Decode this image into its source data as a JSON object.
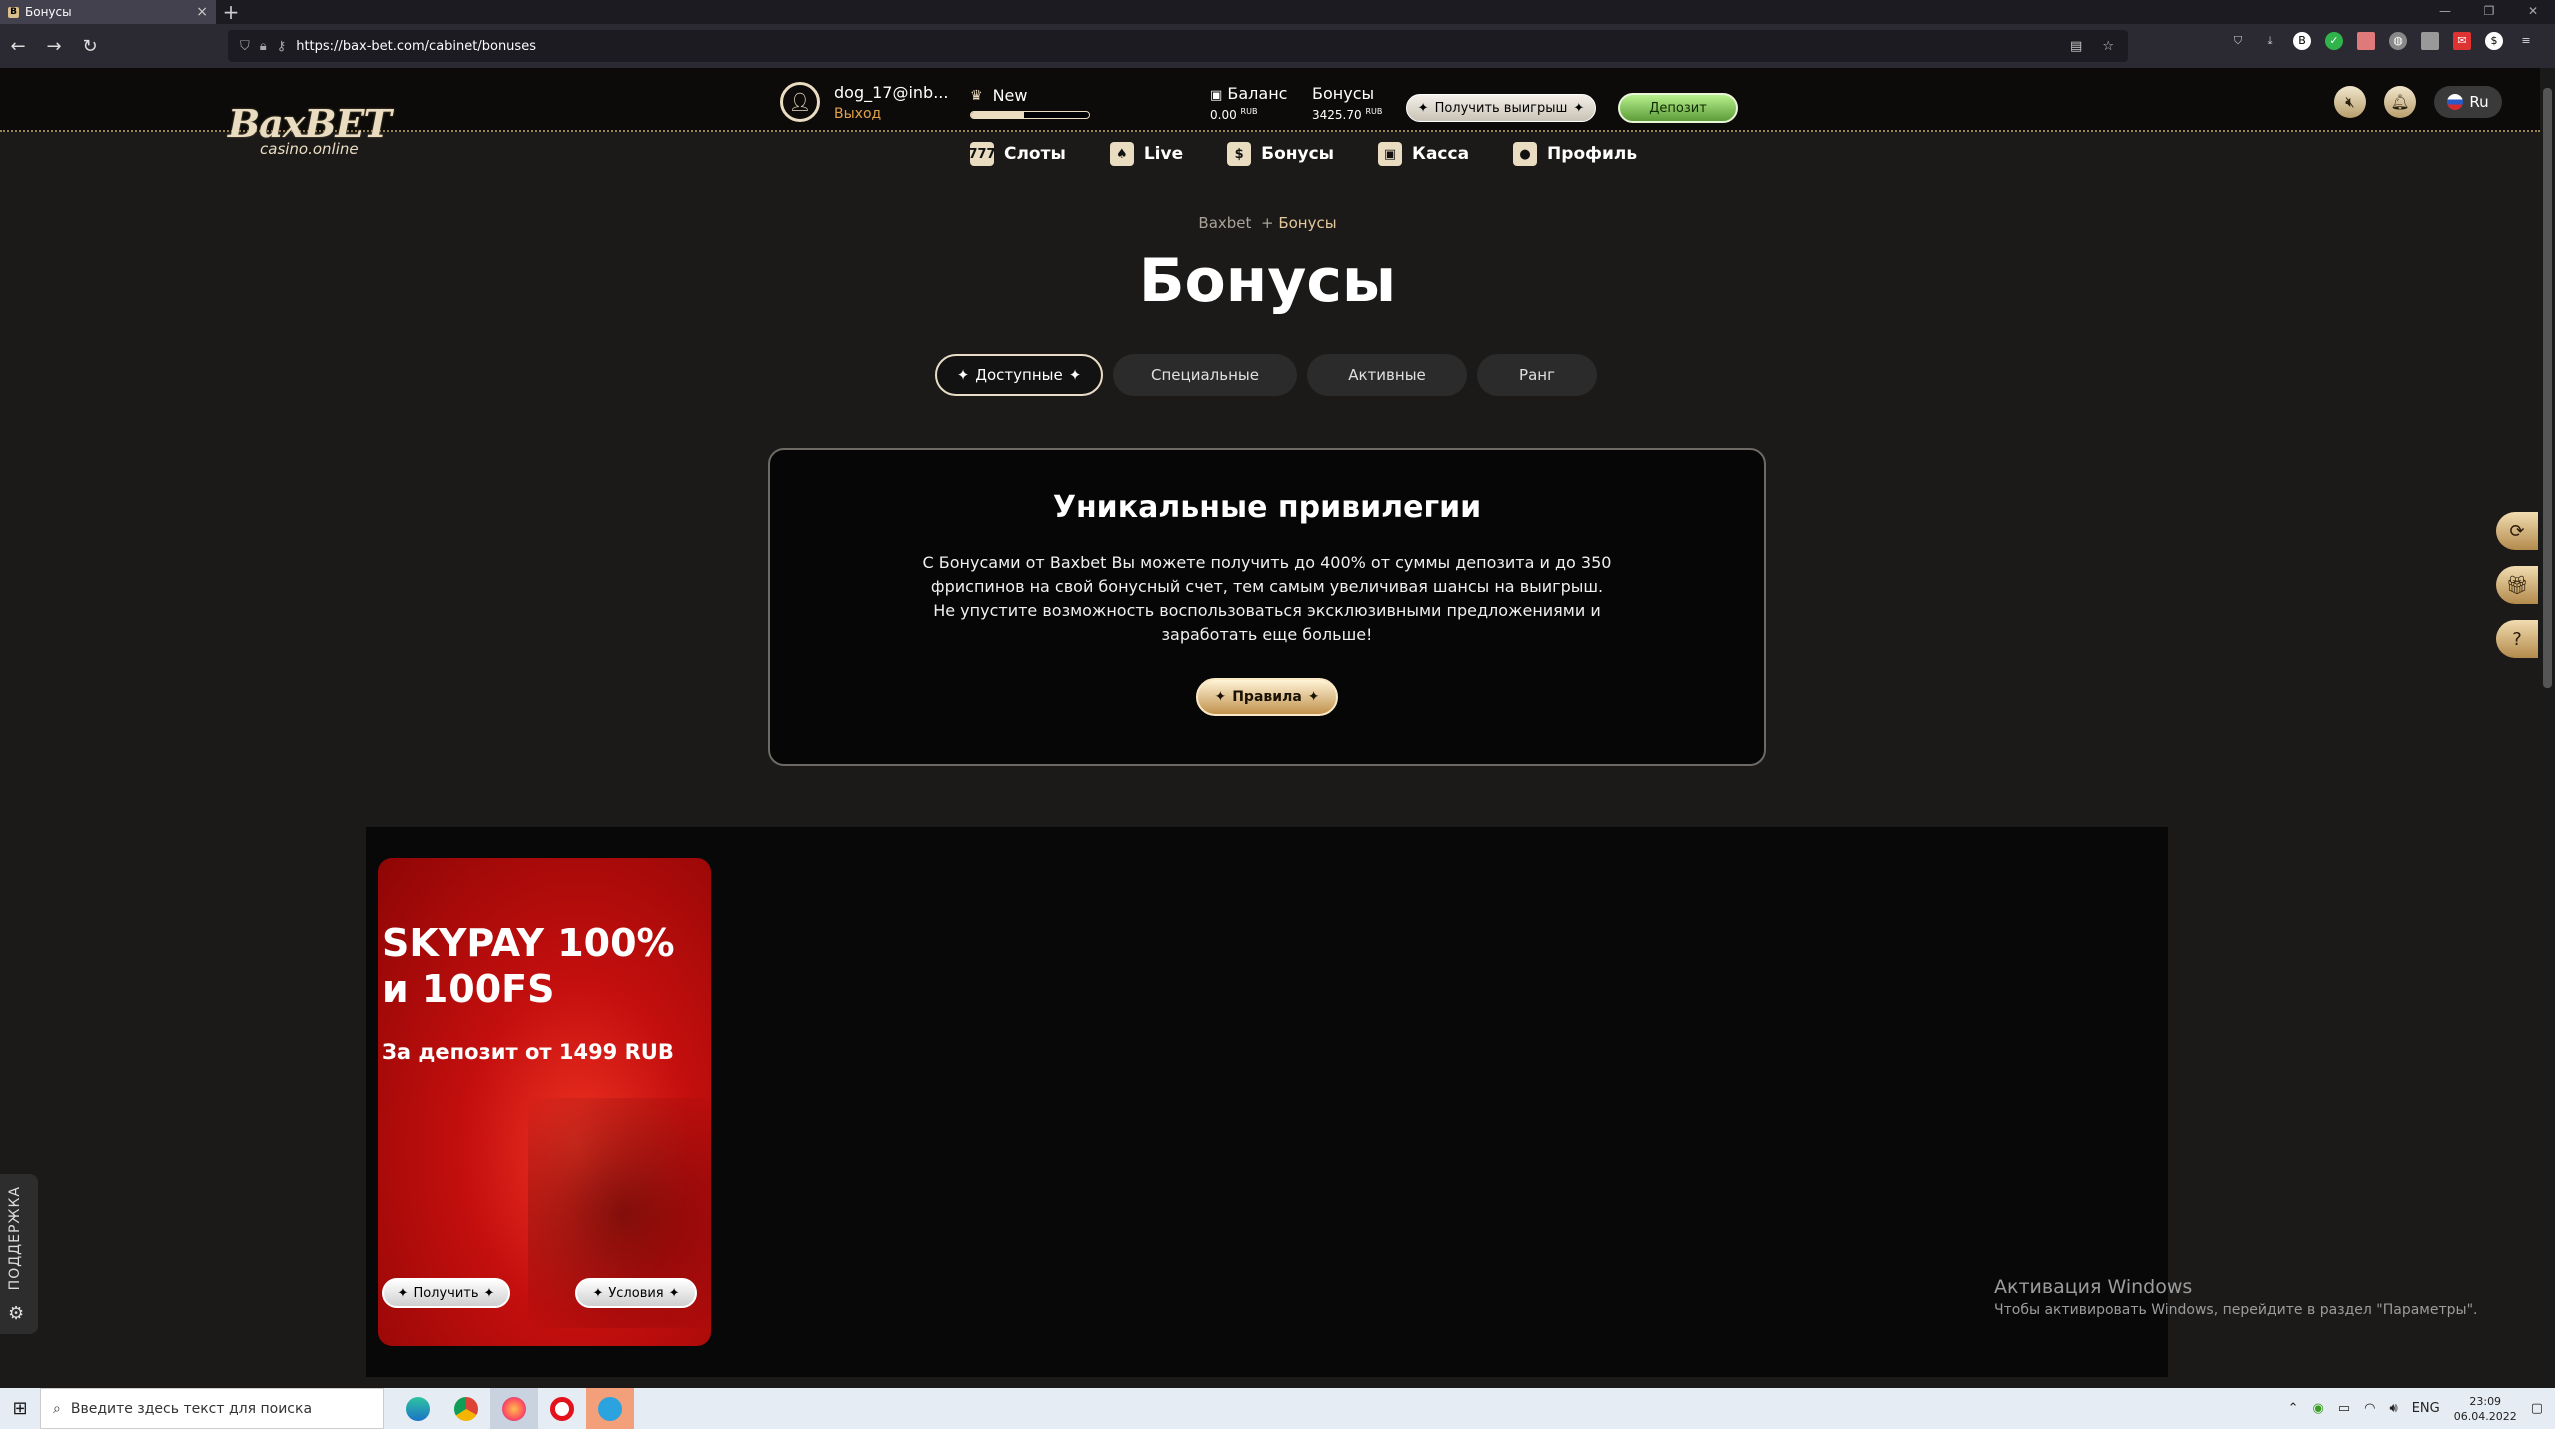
{
  "browser": {
    "tab_title": "Бонусы",
    "url": "https://bax-bet.com/cabinet/bonuses"
  },
  "header": {
    "logo_brand": "BaxBET",
    "logo_tagline": "casino.online",
    "username": "dog_17@inb...",
    "logout": "Выход",
    "level_name": "New",
    "level_progress": 0.45,
    "balance_label": "Баланс",
    "balance_value": "0.00",
    "balance_currency": "RUB",
    "bonus_label": "Бонусы",
    "bonus_value": "3425.70",
    "bonus_currency": "RUB",
    "withdraw_button": "Получить выигрыш",
    "deposit_button": "Депозит",
    "language": "Ru"
  },
  "nav": {
    "items": [
      "Слоты",
      "Live",
      "Бонусы",
      "Касса",
      "Профиль"
    ]
  },
  "breadcrumb": {
    "root": "Baxbet",
    "sep": "+",
    "current": "Бонусы"
  },
  "page": {
    "title": "Бонусы",
    "tabs": [
      "Доступные",
      "Специальные",
      "Активные",
      "Ранг"
    ],
    "active_tab": "Доступные"
  },
  "info": {
    "title": "Уникальные привилегии",
    "line1": "С Бонусами от Baxbet Вы можете получить до 400% от суммы депозита и до 350 фриспинов на свой бонусный счет, тем самым увеличивая шансы на выигрыш.",
    "line2": "Не упустите возможность воспользоваться эксклюзивными предложениями и заработать еще больше!",
    "rules_button": "Правила"
  },
  "promo": {
    "title_line1": "SKYPAY 100%",
    "title_line2": "и 100FS",
    "subtitle": "За депозит от 1499 RUB",
    "get_button": "Получить",
    "terms_button": "Условия"
  },
  "support": {
    "label": "ПОДДЕРЖКА"
  },
  "windows": {
    "activation_title": "Активация Windows",
    "activation_text": "Чтобы активировать Windows, перейдите в раздел \"Параметры\".",
    "search_placeholder": "Введите здесь текст для поиска",
    "lang": "ENG",
    "time": "23:09",
    "date": "06.04.2022"
  },
  "colors": {
    "gold": "#e9dcc1",
    "accent_orange": "#e0a24b",
    "deposit_green": "#7cc255",
    "promo_red": "#c40f0e"
  }
}
